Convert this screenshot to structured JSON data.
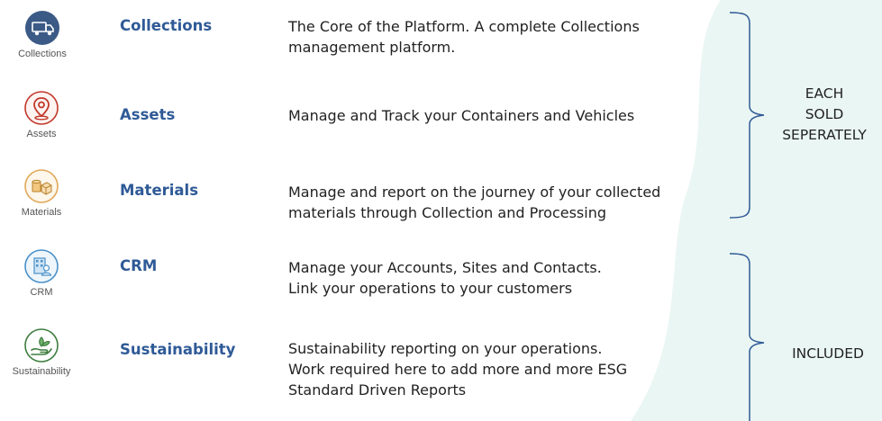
{
  "colors": {
    "module_title": "#2f5a97",
    "description_text": "#222222",
    "caption_text": "#555555",
    "background_shape": "#eaf6f3",
    "brace_line": "#2f5a97",
    "collections_icon": "#3b5a86",
    "assets_icon": "#c0392b",
    "materials_icon": "#e0a85a",
    "crm_icon": "#4a90c8",
    "sustainability_icon": "#3e7d3e"
  },
  "modules": [
    {
      "icon": "truck-icon",
      "caption": "Collections",
      "name": "Collections",
      "description": [
        "The Core of the Platform. A complete Collections",
        "management platform."
      ]
    },
    {
      "icon": "location-pin-icon",
      "caption": "Assets",
      "name": "Assets",
      "description": [
        "Manage and Track your Containers and Vehicles"
      ]
    },
    {
      "icon": "boxes-icon",
      "caption": "Materials",
      "name": "Materials",
      "description": [
        "Manage and report on the journey of your collected",
        "materials through Collection and Processing"
      ]
    },
    {
      "icon": "building-person-icon",
      "caption": "CRM",
      "name": "CRM",
      "description": [
        "Manage your Accounts, Sites and Contacts.",
        "Link your operations to your customers"
      ]
    },
    {
      "icon": "hand-leaf-icon",
      "caption": "Sustainability",
      "name": "Sustainability",
      "description": [
        "Sustainability reporting on your operations.",
        "Work required here to add more and more ESG",
        "Standard Driven Reports"
      ]
    }
  ],
  "groups": [
    {
      "label": [
        "EACH",
        "SOLD",
        "SEPERATELY"
      ]
    },
    {
      "label": [
        "INCLUDED"
      ]
    }
  ]
}
